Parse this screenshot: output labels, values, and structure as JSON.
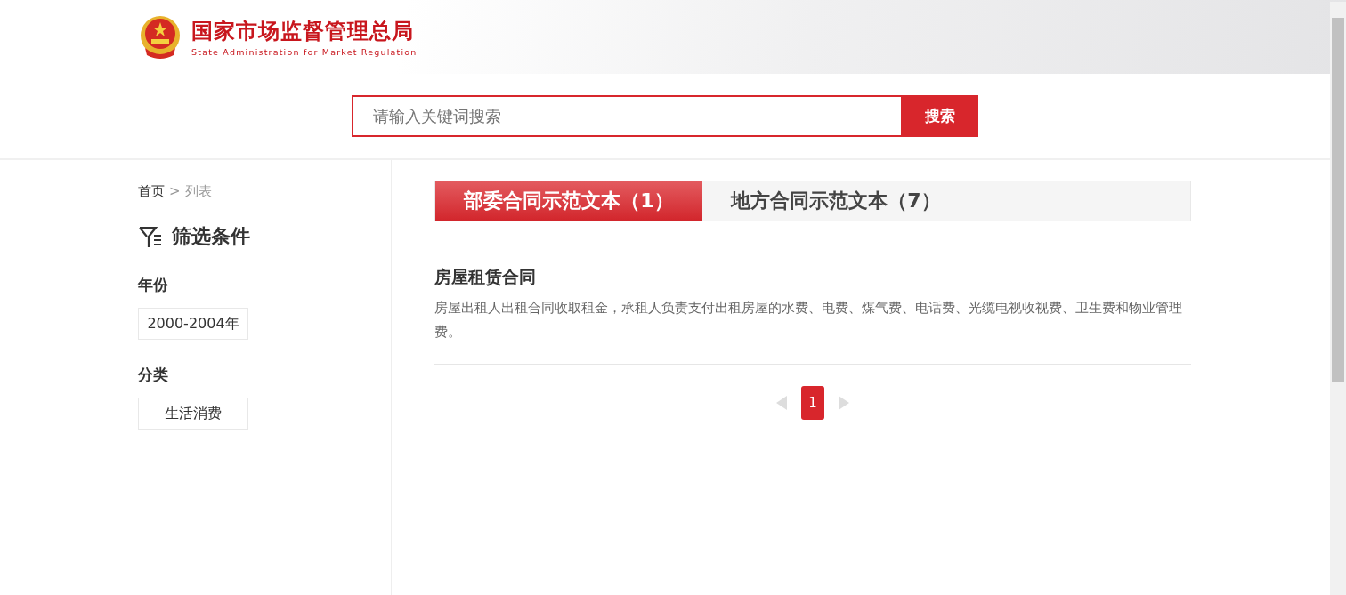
{
  "header": {
    "title": "国家市场监督管理总局",
    "subtitle": "State Administration for Market Regulation"
  },
  "search": {
    "placeholder": "请输入关键词搜索",
    "button": "搜索"
  },
  "breadcrumb": {
    "home": "首页",
    "separator": ">",
    "current": "列表"
  },
  "filter": {
    "title": "筛选条件",
    "groups": [
      {
        "label": "年份",
        "options": [
          {
            "label": "2000-2004年"
          }
        ]
      },
      {
        "label": "分类",
        "options": [
          {
            "label": "生活消费"
          }
        ]
      }
    ]
  },
  "tabs": [
    {
      "label": "部委合同示范文本（1）",
      "selected": true
    },
    {
      "label": "地方合同示范文本（7）",
      "selected": false
    }
  ],
  "results": [
    {
      "title": "房屋租赁合同",
      "description": "房屋出租人出租合同收取租金，承租人负责支付出租房屋的水费、电费、煤气费、电话费、光缆电视收视费、卫生费和物业管理费。"
    }
  ],
  "pagination": {
    "pages": [
      {
        "label": "1",
        "selected": true
      }
    ]
  }
}
